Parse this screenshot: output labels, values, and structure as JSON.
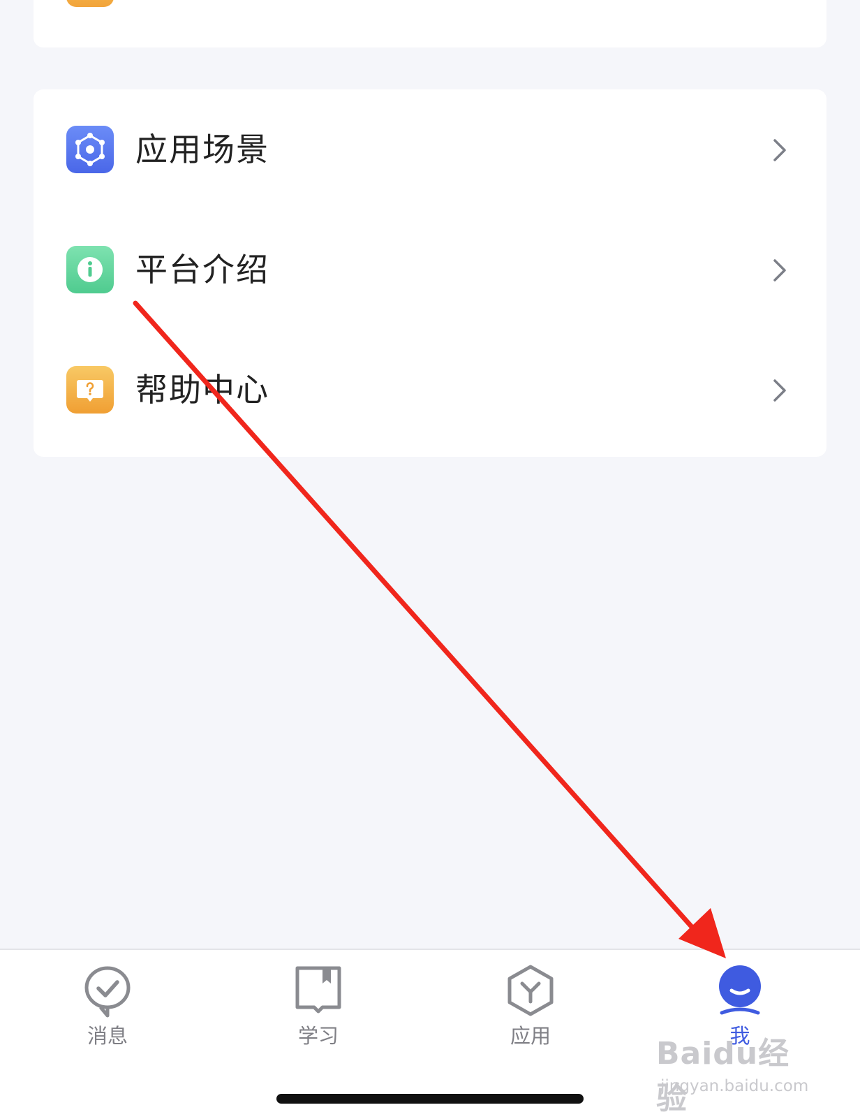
{
  "menu": {
    "items": [
      {
        "label": "应用场景",
        "icon": "apps-scene-icon",
        "color": "#5b7cf2"
      },
      {
        "label": "平台介绍",
        "icon": "info-icon",
        "color": "#5fd19a"
      },
      {
        "label": "帮助中心",
        "icon": "help-chat-icon",
        "color": "#f2ad3a"
      }
    ]
  },
  "tabbar": {
    "tabs": [
      {
        "label": "消息",
        "icon": "message-check-icon",
        "active": false
      },
      {
        "label": "学习",
        "icon": "book-icon",
        "active": false
      },
      {
        "label": "应用",
        "icon": "cube-app-icon",
        "active": false
      },
      {
        "label": "我",
        "icon": "profile-icon",
        "active": true
      }
    ]
  },
  "watermark": {
    "brand": "Baidu经验",
    "site": "jingyan.baidu.com"
  },
  "colors": {
    "accent": "#3f5be0",
    "annotation_arrow": "#f0261c",
    "background": "#f5f6fa"
  }
}
